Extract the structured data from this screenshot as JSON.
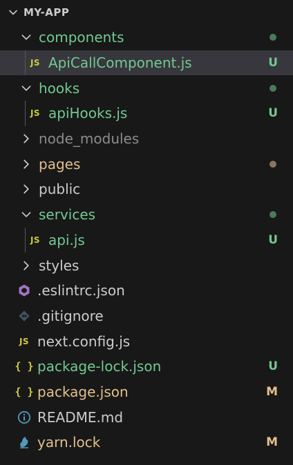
{
  "colors": {
    "untracked": "#73c991",
    "modified": "#e2c08d",
    "ignored": "#8c8c8c",
    "default": "#cccccc",
    "js": "#cbcb41",
    "eslint": "#a074c4",
    "git": "#41535b",
    "info": "#519aba",
    "yarn": "#519aba",
    "untracked_dot": "#4b7a5b",
    "modified_dot": "#8a7560"
  },
  "explorer": {
    "root_label": "MY-APP",
    "items": [
      {
        "label": "components",
        "kind": "folder",
        "expanded": true,
        "depth": 0,
        "status": "dot",
        "status_color": "untracked"
      },
      {
        "label": "ApiCallComponent.js",
        "kind": "file",
        "icon": "js-icon",
        "depth": 1,
        "status": "U",
        "status_color": "untracked",
        "selected": true
      },
      {
        "label": "hooks",
        "kind": "folder",
        "expanded": true,
        "depth": 0,
        "status": "dot",
        "status_color": "untracked"
      },
      {
        "label": "apiHooks.js",
        "kind": "file",
        "icon": "js-icon",
        "depth": 1,
        "status": "U",
        "status_color": "untracked"
      },
      {
        "label": "node_modules",
        "kind": "folder",
        "expanded": false,
        "depth": 0,
        "status": "",
        "status_color": "ignored"
      },
      {
        "label": "pages",
        "kind": "folder",
        "expanded": false,
        "depth": 0,
        "status": "dot",
        "status_color": "modified"
      },
      {
        "label": "public",
        "kind": "folder",
        "expanded": false,
        "depth": 0,
        "status": "",
        "status_color": "default"
      },
      {
        "label": "services",
        "kind": "folder",
        "expanded": true,
        "depth": 0,
        "status": "dot",
        "status_color": "untracked"
      },
      {
        "label": "api.js",
        "kind": "file",
        "icon": "js-icon",
        "depth": 1,
        "status": "U",
        "status_color": "untracked"
      },
      {
        "label": "styles",
        "kind": "folder",
        "expanded": false,
        "depth": 0,
        "status": "",
        "status_color": "default"
      },
      {
        "label": ".eslintrc.json",
        "kind": "file",
        "icon": "eslint-icon",
        "depth": 0,
        "status": "",
        "status_color": "default"
      },
      {
        "label": ".gitignore",
        "kind": "file",
        "icon": "git-icon",
        "depth": 0,
        "status": "",
        "status_color": "default"
      },
      {
        "label": "next.config.js",
        "kind": "file",
        "icon": "js-icon",
        "depth": 0,
        "status": "",
        "status_color": "default"
      },
      {
        "label": "package-lock.json",
        "kind": "file",
        "icon": "json-icon",
        "depth": 0,
        "status": "U",
        "status_color": "untracked"
      },
      {
        "label": "package.json",
        "kind": "file",
        "icon": "json-icon",
        "depth": 0,
        "status": "M",
        "status_color": "modified"
      },
      {
        "label": "README.md",
        "kind": "file",
        "icon": "info-icon",
        "depth": 0,
        "status": "",
        "status_color": "default"
      },
      {
        "label": "yarn.lock",
        "kind": "file",
        "icon": "yarn-icon",
        "depth": 0,
        "status": "M",
        "status_color": "modified"
      }
    ]
  }
}
